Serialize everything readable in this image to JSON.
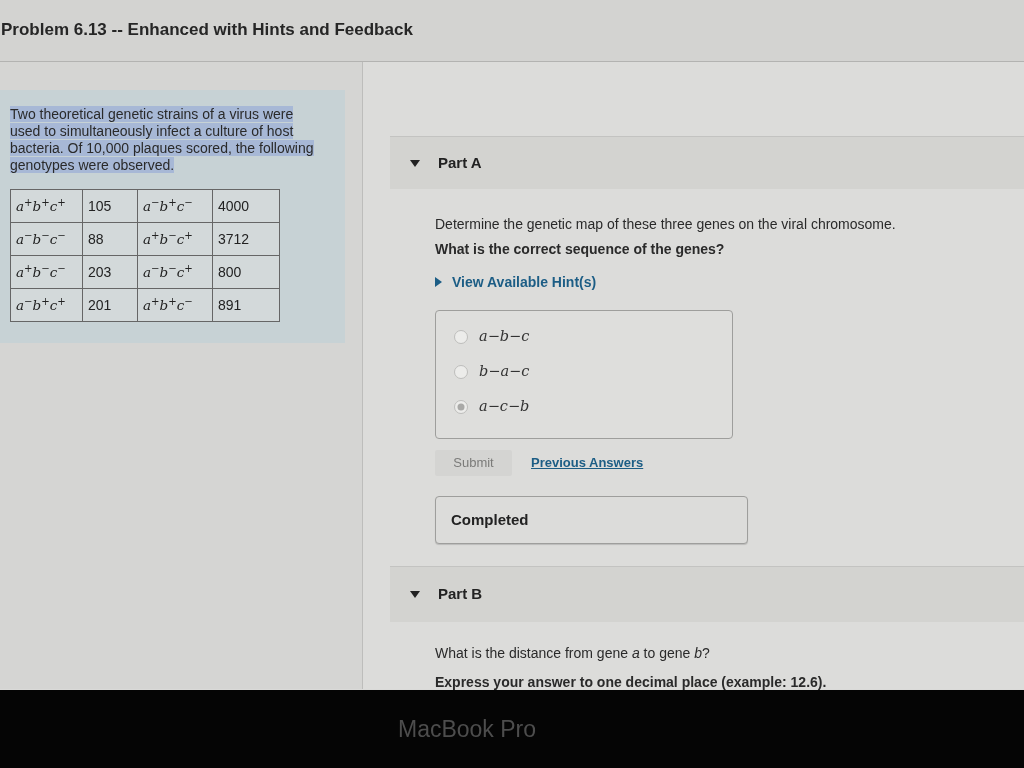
{
  "header": {
    "title": "Problem 6.13 -- Enhanced with Hints and Feedback"
  },
  "problem": {
    "intro": {
      "text": "Two theoretical genetic strains of a virus were used to simultaneously infect a culture of host bacteria. Of 10,000 plaques scored, the following genotypes were observed.",
      "highlighted": true
    },
    "genotype_table": {
      "rows": [
        [
          "*a*$^{+}$*b*$^{+}$*c*$^{+}$",
          "105",
          "*a*$^{−}$*b*$^{+}$*c*$^{−}$",
          "4000"
        ],
        [
          "*a*$^{−}$*b*$^{−}$*c*$^{−}$",
          "88",
          "*a*$^{+}$*b*$^{−}$*c*$^{+}$",
          "3712"
        ],
        [
          "*a*$^{+}$*b*$^{−}$*c*$^{−}$",
          "203",
          "*a*$^{−}$*b*$^{−}$*c*$^{+}$",
          "800"
        ],
        [
          "*a*$^{−}$*b*$^{+}$*c*$^{+}$",
          "201",
          "*a*$^{+}$*b*$^{+}$*c*$^{−}$",
          "891"
        ]
      ]
    }
  },
  "parts": [
    {
      "title": "Part A",
      "expanded": true,
      "body": [
        {
          "kind": "text",
          "text": "Determine the genetic map of these three genes on the viral chromosome."
        },
        {
          "kind": "prompt",
          "text": "What is the correct sequence of the genes?"
        },
        {
          "kind": "hints",
          "label": "View Available Hint(s)",
          "expanded": false
        },
        {
          "kind": "choices",
          "disabled": true,
          "options": [
            {
              "label": "*a*−*b*−*c*",
              "selected": false
            },
            {
              "label": "*b*−*a*−*c*",
              "selected": false
            },
            {
              "label": "*a*−*c*−*b*",
              "selected": true
            }
          ]
        },
        {
          "kind": "actions",
          "submit": {
            "label": "Submit",
            "disabled": true
          },
          "link": "Previous Answers"
        },
        {
          "kind": "status",
          "text": "Completed"
        }
      ]
    },
    {
      "title": "Part B",
      "expanded": true,
      "body": [
        {
          "kind": "text",
          "text": "What is the distance from gene *a* to gene *b*?"
        },
        {
          "kind": "prompt",
          "text": "Express your answer to one decimal place (example: 12.6)."
        }
      ]
    }
  ],
  "bezel": {
    "label": "MacBook Pro"
  }
}
